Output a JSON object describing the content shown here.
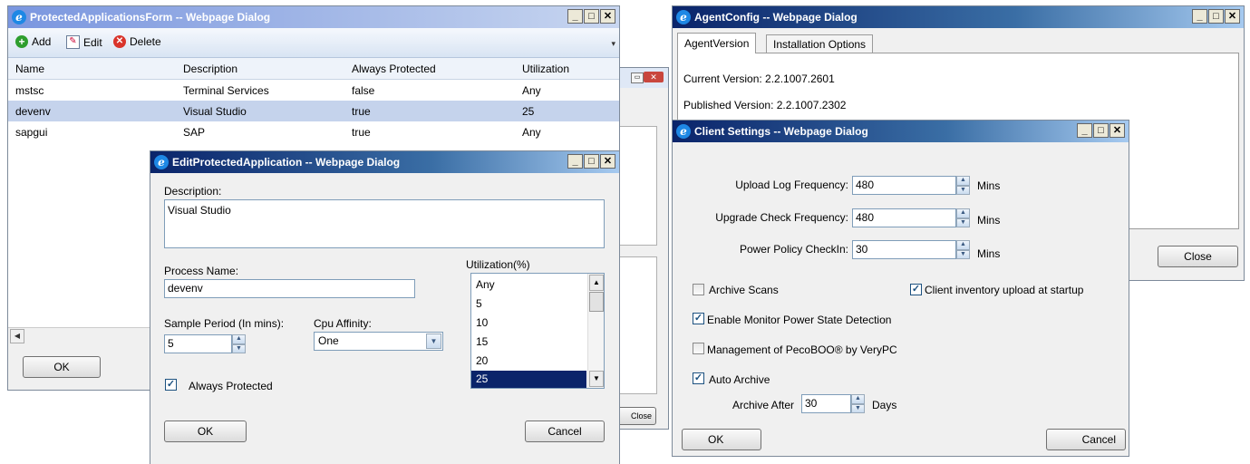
{
  "protected_form": {
    "title": "ProtectedApplicationsForm -- Webpage Dialog",
    "toolbar": {
      "add": "Add",
      "edit": "Edit",
      "delete": "Delete"
    },
    "columns": [
      "Name",
      "Description",
      "Always Protected",
      "Utilization"
    ],
    "rows": [
      [
        "mstsc",
        "Terminal Services",
        "false",
        "Any"
      ],
      [
        "devenv",
        "Visual Studio",
        "true",
        "25"
      ],
      [
        "sapgui",
        "SAP",
        "true",
        "Any"
      ]
    ],
    "ok": "OK"
  },
  "partial_window": {
    "close": "Close"
  },
  "edit_dialog": {
    "title": "EditProtectedApplication -- Webpage Dialog",
    "description_label": "Description:",
    "description_value": "Visual Studio",
    "process_label": "Process Name:",
    "process_value": "devenv",
    "sample_label": "Sample Period (In mins):",
    "sample_value": "5",
    "cpu_label": "Cpu Affinity:",
    "cpu_value": "One",
    "util_label": "Utilization(%)",
    "util_options": [
      "Any",
      "5",
      "10",
      "15",
      "20",
      "25"
    ],
    "util_selected": "25",
    "always_protected": "Always Protected",
    "always_protected_checked": true,
    "ok": "OK",
    "cancel": "Cancel"
  },
  "agent_config": {
    "title": "AgentConfig -- Webpage Dialog",
    "tabs": [
      "AgentVersion",
      "Installation Options"
    ],
    "current_version": "Current Version: 2.2.1007.2601",
    "published_version": "Published Version: 2.2.1007.2302",
    "close": "Close"
  },
  "client_settings": {
    "title": "Client Settings -- Webpage Dialog",
    "upload_label": "Upload Log Frequency:",
    "upload_value": "480",
    "upgrade_label": "Upgrade Check Frequency:",
    "upgrade_value": "480",
    "power_label": "Power Policy CheckIn:",
    "power_value": "30",
    "unit_mins": "Mins",
    "archive_scans": "Archive Scans",
    "client_inventory": "Client inventory upload at startup",
    "enable_monitor": "Enable Monitor Power State Detection",
    "management": "Management of PecoBOO® by VeryPC",
    "auto_archive": "Auto Archive",
    "archive_after_label": "Archive After",
    "archive_after_value": "30",
    "unit_days": "Days",
    "ok": "OK",
    "cancel": "Cancel"
  },
  "colors": {
    "selected_row": "#c5d3ec",
    "listbox_selected": "#0a246a",
    "titlebar": "#0a246a"
  }
}
